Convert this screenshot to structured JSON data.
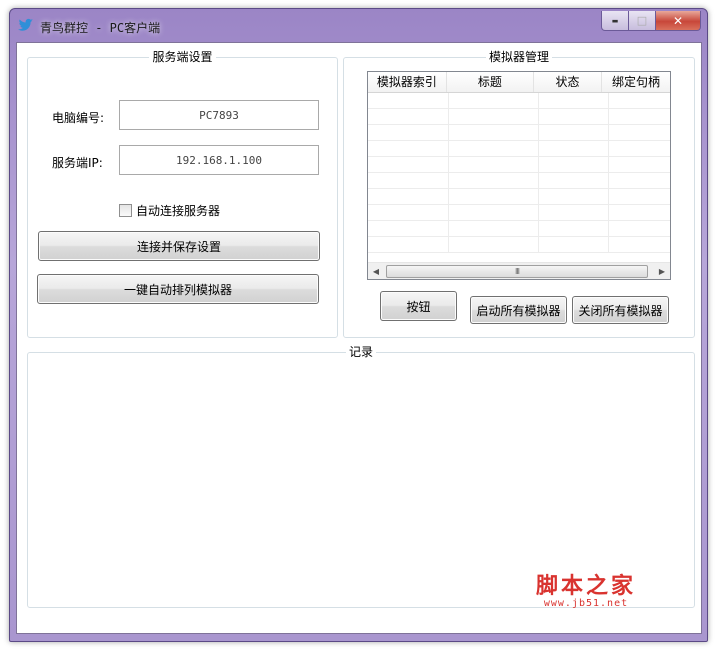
{
  "window": {
    "title": "青鸟群控 - PC客户端",
    "buttons": {
      "minimize": "▬",
      "maximize": "□",
      "close": "✕"
    }
  },
  "server_settings": {
    "group_title": "服务端设置",
    "pc_number_label": "电脑编号:",
    "pc_number_value": "PC7893",
    "server_ip_label": "服务端IP:",
    "server_ip_value": "192.168.1.100",
    "auto_connect_label": "自动连接服务器",
    "auto_connect_checked": false,
    "connect_save_button": "连接并保存设置",
    "auto_arrange_button": "一键自动排列模拟器"
  },
  "emulator_manager": {
    "group_title": "模拟器管理",
    "columns": [
      "模拟器索引",
      "标题",
      "状态",
      "绑定句柄"
    ],
    "rows": [],
    "scroll_grip": "III",
    "button": "按钮",
    "start_all_button": "启动所有模拟器",
    "close_all_button": "关闭所有模拟器"
  },
  "log": {
    "group_title": "记录"
  },
  "watermark": {
    "main": "脚本之家",
    "url": "www.jb51.net"
  },
  "colors": {
    "frame": "#a996cf",
    "close_button": "#c8473a",
    "watermark": "#d9332f"
  }
}
